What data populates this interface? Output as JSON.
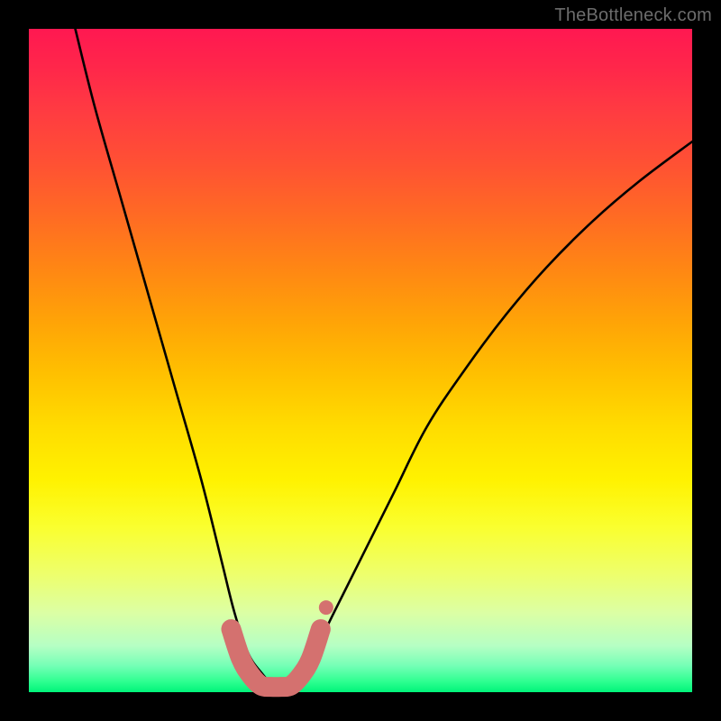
{
  "watermark": "TheBottleneck.com",
  "chart_data": {
    "type": "line",
    "title": "",
    "xlabel": "",
    "ylabel": "",
    "xlim": [
      0,
      100
    ],
    "ylim": [
      0,
      100
    ],
    "grid": false,
    "series": [
      {
        "name": "bottleneck-curve",
        "x": [
          7,
          10,
          14,
          18,
          22,
          26,
          29,
          31,
          33,
          35,
          37,
          39,
          41,
          43,
          46,
          50,
          55,
          60,
          66,
          72,
          78,
          85,
          92,
          100
        ],
        "values": [
          100,
          88,
          74,
          60,
          46,
          32,
          20,
          12,
          6,
          3,
          1,
          1,
          3,
          6,
          12,
          20,
          30,
          40,
          49,
          57,
          64,
          71,
          77,
          83
        ],
        "stroke": "#000000",
        "stroke_width": 2.6
      }
    ],
    "marker_band": {
      "name": "optimal-range-overlay",
      "color": "#d4716f",
      "x": [
        30.5,
        32,
        33.5,
        35,
        36.5,
        38,
        39.5,
        41,
        42.5,
        44
      ],
      "values": [
        9.5,
        5,
        2.5,
        1,
        0.8,
        0.8,
        1,
        2.5,
        5,
        9.5
      ]
    },
    "background_gradient": {
      "top": "#ff1851",
      "mid": "#ffdc00",
      "bottom": "#00f47a"
    }
  }
}
